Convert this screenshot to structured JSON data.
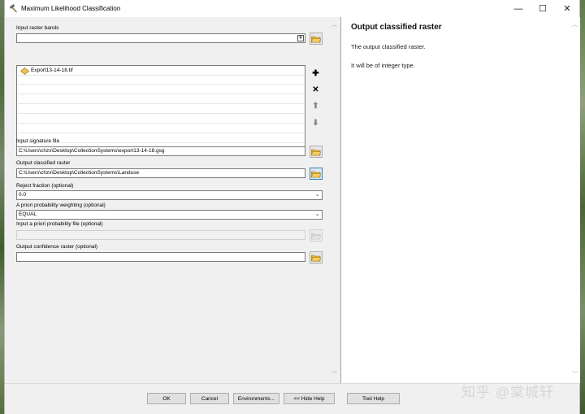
{
  "window": {
    "title": "Maximum Likelihood Classification",
    "controls": {
      "minimize": "—",
      "maximize": "☐",
      "close": "✕"
    }
  },
  "form": {
    "input_raster_bands": {
      "label": "Input raster bands",
      "value": "",
      "items": [
        "Export13-14-18.tif"
      ],
      "side_buttons": {
        "add": "✚",
        "remove": "✕",
        "up": "⬆",
        "down": "⬇"
      }
    },
    "signature_file": {
      "label": "Input signature file",
      "value": "C:\\Users\\chzx\\Desktop\\CollectionSystems\\export13-14-18.gsg"
    },
    "output_raster": {
      "label": "Output classified raster",
      "value": "C:\\Users\\chzx\\Desktop\\CollectionSystems\\Landuse"
    },
    "reject_fraction": {
      "label": "Reject fraction (optional)",
      "value": "0.0"
    },
    "apriori_weighting": {
      "label": "A priori probability weighting (optional)",
      "value": "EQUAL"
    },
    "apriori_file": {
      "label": "Input a priori probability file (optional)",
      "value": ""
    },
    "confidence_raster": {
      "label": "Output confidence raster (optional)",
      "value": ""
    }
  },
  "help": {
    "title": "Output classified raster",
    "paragraphs": [
      "The output classified raster.",
      "It will be of integer type."
    ]
  },
  "buttons": {
    "ok": "OK",
    "cancel": "Cancel",
    "environments": "Environments...",
    "hide_help": "<< Hide Help",
    "tool_help": "Tool Help"
  },
  "watermark": "知乎 @棠城轩",
  "icons": {
    "title": "hammer-icon",
    "folder": "open-folder-icon",
    "raster": "raster-layer-icon"
  },
  "colors": {
    "window_bg": "#f0f0f0",
    "active_border": "#3c7fb1",
    "add_icon": "#000000",
    "remove_icon": "#000000"
  }
}
